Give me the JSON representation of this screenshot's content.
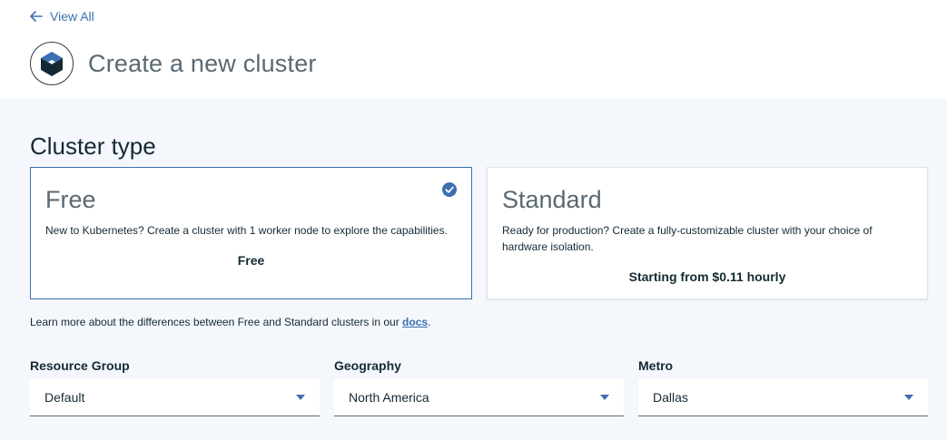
{
  "header": {
    "back_label": "View All",
    "page_title": "Create a new cluster"
  },
  "cluster_type": {
    "section_title": "Cluster type",
    "options": [
      {
        "title": "Free",
        "description": "New to Kubernetes? Create a cluster with 1 worker node to explore the capabilities.",
        "price": "Free",
        "selected": true
      },
      {
        "title": "Standard",
        "description": "Ready for production? Create a fully-customizable cluster with your choice of hardware isolation.",
        "price": "Starting from $0.11 hourly",
        "selected": false
      }
    ]
  },
  "docs_note": {
    "prefix": "Learn more about the differences between Free and Standard clusters in our ",
    "link_label": "docs",
    "suffix": "."
  },
  "fields": {
    "resource_group": {
      "label": "Resource Group",
      "value": "Default"
    },
    "geography": {
      "label": "Geography",
      "value": "North America"
    },
    "metro": {
      "label": "Metro",
      "value": "Dallas"
    }
  },
  "colors": {
    "accent": "#3d70b2",
    "panel_background": "#f4f7fb",
    "text": "#152935",
    "muted_text": "#5a6872"
  },
  "icons": {
    "back": "arrow-left-icon",
    "logo": "kubernetes-cube-icon",
    "selected": "checkmark-icon",
    "dropdown": "chevron-down-icon"
  }
}
